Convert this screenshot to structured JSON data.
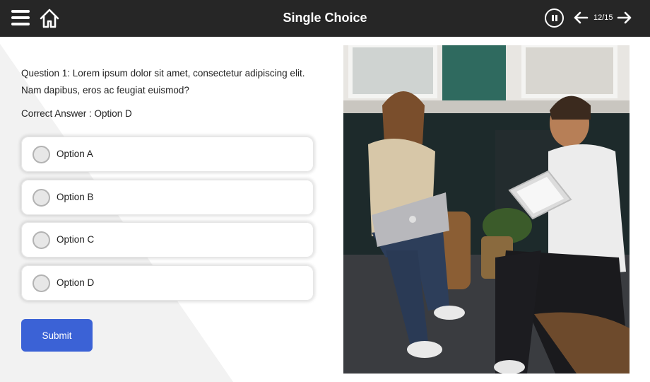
{
  "header": {
    "title": "Single Choice",
    "counter": "12/15",
    "menu_icon": "hamburger-menu-icon",
    "home_icon": "home-icon",
    "pause_icon": "pause-icon",
    "prev_icon": "arrow-left-icon",
    "next_icon": "arrow-right-icon"
  },
  "question": {
    "text": "Question 1: Lorem ipsum dolor sit amet, consectetur adipiscing elit. Nam dapibus, eros ac feugiat euismod?",
    "correct_answer": "Correct Answer : Option D"
  },
  "options": [
    {
      "label": "Option A"
    },
    {
      "label": "Option B"
    },
    {
      "label": "Option C"
    },
    {
      "label": "Option D"
    }
  ],
  "submit_label": "Submit",
  "colors": {
    "topbar": "#262626",
    "accent": "#3b62d6",
    "background": "#f2f2f2"
  }
}
